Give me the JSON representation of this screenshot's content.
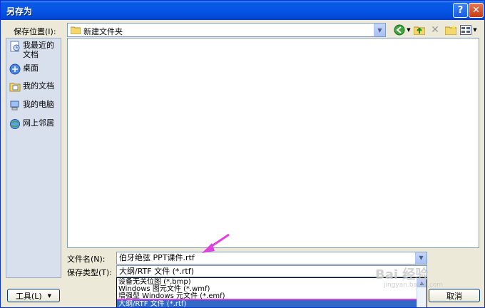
{
  "dialog": {
    "title": "另存为",
    "help_glyph": "?",
    "close_glyph": "✕"
  },
  "location": {
    "label": "保存位置(I):",
    "value": "新建文件夹"
  },
  "places": [
    {
      "label": "我最近的文档",
      "icon": "recent-documents-icon"
    },
    {
      "label": "桌面",
      "icon": "desktop-icon"
    },
    {
      "label": "我的文档",
      "icon": "my-documents-icon"
    },
    {
      "label": "我的电脑",
      "icon": "my-computer-icon"
    },
    {
      "label": "网上邻居",
      "icon": "network-places-icon"
    }
  ],
  "filename": {
    "label": "文件名(N):",
    "value": "伯牙绝弦 PPT课件.rtf"
  },
  "filetype": {
    "label": "保存类型(T):",
    "value": "大纲/RTF 文件 (*.rtf)",
    "options": [
      "设备无关位图 (*.bmp)",
      "Windows 图元文件 (*.wmf)",
      "增强型 Windows 元文件 (*.emf)",
      "大纲/RTF 文件 (*.rtf)"
    ]
  },
  "buttons": {
    "tools": "工具(L)",
    "cancel": "取消"
  },
  "watermark": {
    "brand": "Bai 经验",
    "url": "jingyan.baidu.com"
  },
  "colors": {
    "annotation_arrow": "#e040e0",
    "selection": "#316ac5"
  }
}
